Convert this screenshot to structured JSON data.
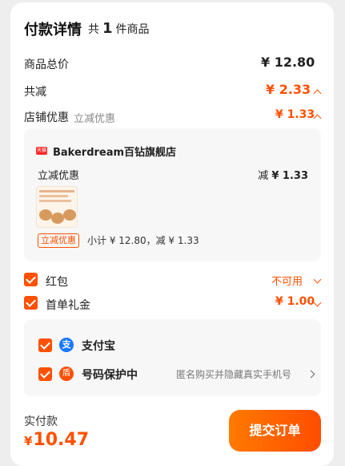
{
  "header": {
    "title": "付款详情",
    "count_prefix": "共",
    "count": "1",
    "count_suffix": "件商品"
  },
  "summary": {
    "goods_total_label": "商品总价",
    "goods_total": "¥ 12.80",
    "discount_label": "共减",
    "discount_total": "¥ 2.33",
    "store_discount_label": "店铺优惠",
    "store_discount_sub": "立减优惠",
    "store_discount": "¥ 1.33"
  },
  "store": {
    "badge": "天猫",
    "name": "Bakerdream百钻旗舰店",
    "coupon_label": "立减优惠",
    "coupon_prefix": "减",
    "coupon_amount": "¥ 1.33",
    "tag": "立减优惠",
    "subtotal": "小计 ¥ 12.80，减 ¥ 1.33"
  },
  "options": [
    {
      "label": "红包",
      "value": "不可用",
      "checked": true
    },
    {
      "label": "首单礼金",
      "value": "¥ 1.00",
      "checked": true
    }
  ],
  "payment": {
    "alipay_icon": "支",
    "alipay_label": "支付宝",
    "privacy_icon": "盾",
    "privacy_label": "号码保护中",
    "privacy_desc": "匿名购买并隐藏真实手机号"
  },
  "footer": {
    "total_label": "实付款",
    "currency": "¥",
    "total": "10.47",
    "submit": "提交订单"
  },
  "colors": {
    "accent": "#ff5000",
    "alipay": "#1677ff",
    "card": "#f7f7f7"
  }
}
